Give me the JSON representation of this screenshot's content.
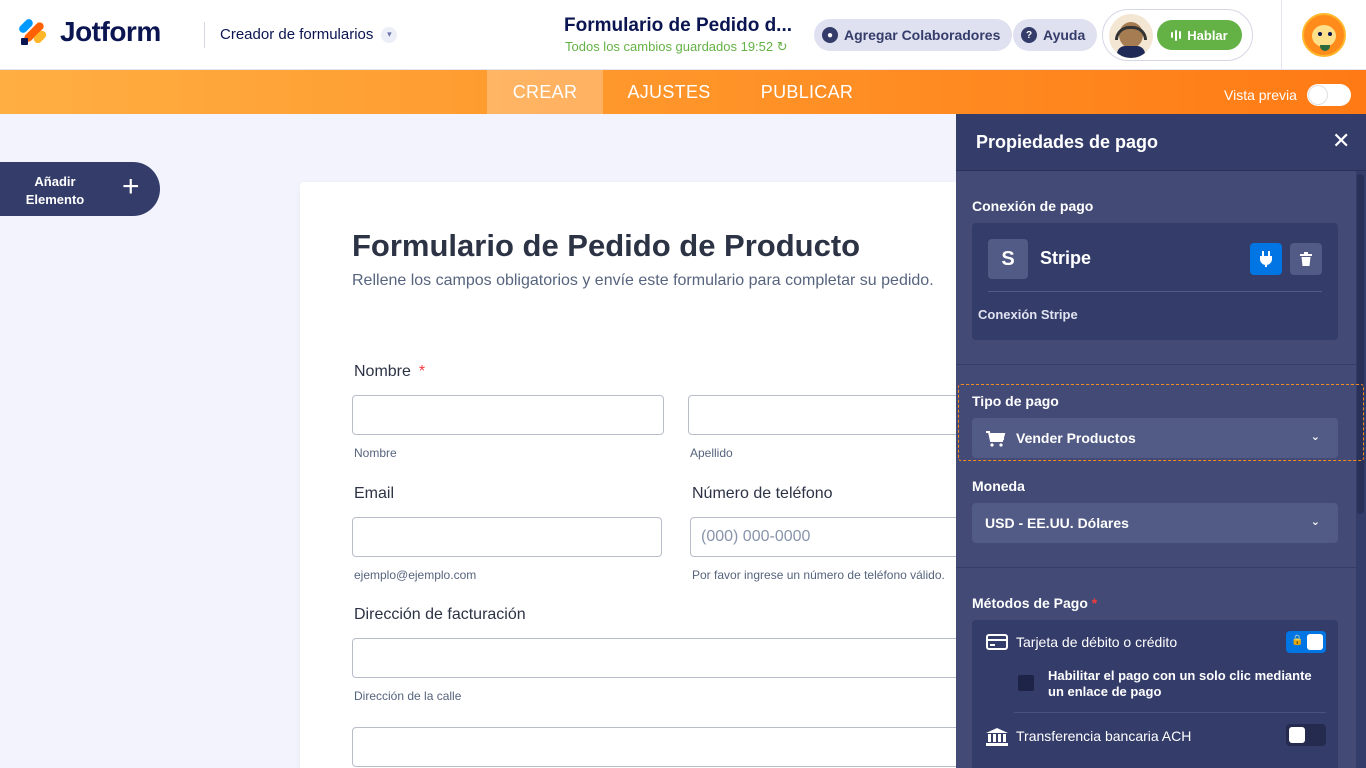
{
  "header": {
    "logo_text": "Jotform",
    "builder_label": "Creador de formularios",
    "form_name": "Formulario de Pedido d...",
    "save_status": "Todos los cambios guardados 19:52",
    "collaborators_label": "Agregar Colaboradores",
    "help_label": "Ayuda",
    "talk_label": "Hablar"
  },
  "nav": {
    "tabs": [
      {
        "label": "CREAR",
        "active": true
      },
      {
        "label": "AJUSTES",
        "active": false
      },
      {
        "label": "PUBLICAR",
        "active": false
      }
    ],
    "preview_label": "Vista previa",
    "preview_on": false
  },
  "add_element": {
    "line1": "Añadir",
    "line2": "Elemento"
  },
  "form": {
    "title": "Formulario de Pedido de Producto",
    "subtitle": "Rellene los campos obligatorios y envíe este formulario para completar su pedido.",
    "name_label": "Nombre",
    "required_mark": "*",
    "first_name_hint": "Nombre",
    "last_name_hint": "Apellido",
    "email_label": "Email",
    "email_hint": "ejemplo@ejemplo.com",
    "phone_label": "Número de teléfono",
    "phone_placeholder": "(000) 000-0000",
    "phone_hint": "Por favor ingrese un número de teléfono válido.",
    "billing_label": "Dirección de facturación",
    "street_hint": "Dirección de la calle"
  },
  "panel": {
    "title": "Propiedades de pago",
    "connection_label": "Conexión de pago",
    "gateway_initial": "S",
    "gateway_name": "Stripe",
    "gateway_connection": "Conexión Stripe",
    "payment_type_label": "Tipo de pago",
    "payment_type_value": "Vender Productos",
    "currency_label": "Moneda",
    "currency_value": "USD - EE.UU. Dólares",
    "methods_label": "Métodos de Pago",
    "methods_required": "*",
    "methods": [
      {
        "label": "Tarjeta de débito o crédito",
        "enabled": true,
        "icon": "credit-card-icon"
      },
      {
        "label": "Transferencia bancaria ACH",
        "enabled": false,
        "icon": "bank-icon"
      }
    ],
    "one_click_label": "Habilitar el pago con un solo clic mediante un enlace de pago"
  },
  "colors": {
    "brand_navy": "#0a1551",
    "accent_orange": "#ff7a14",
    "panel_bg": "#424a75",
    "success_green": "#64b245",
    "primary_blue": "#0075e3"
  }
}
